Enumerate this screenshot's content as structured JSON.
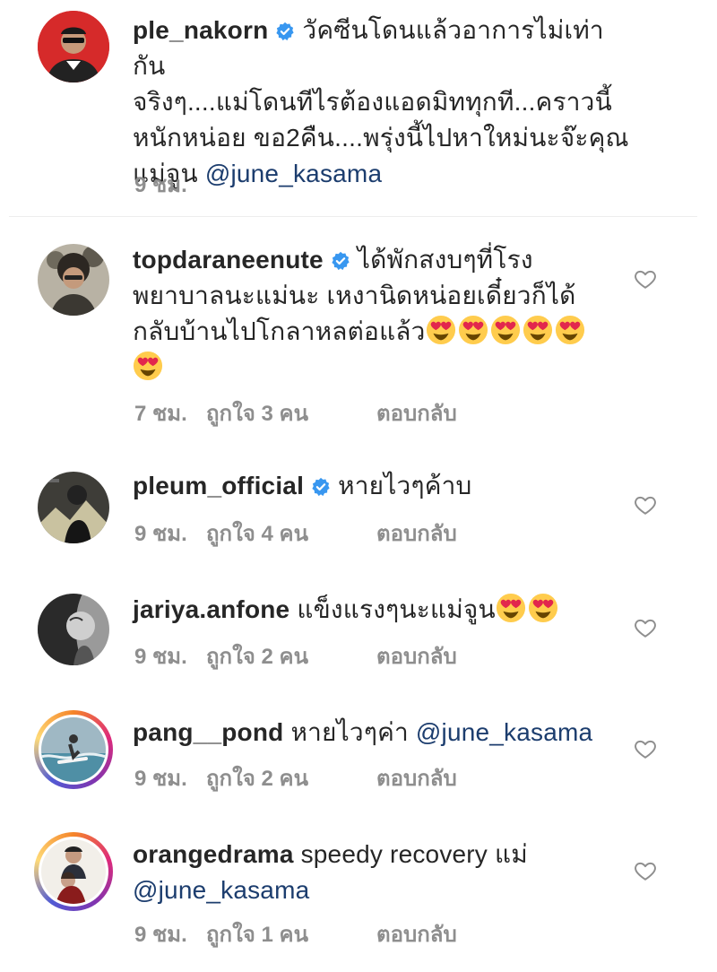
{
  "comments": [
    {
      "username": "ple_nakorn",
      "verified": true,
      "text": "วัคซีนโดนแล้วอาการไม่เท่ากันจริงๆ....แม่โดนทีไรต้องแอดมิททุกที...คราวนี้หนักหน่อย ขอ2คืน....พรุ่งนี้ไปหาใหม่นะจ๊ะคุณแม่จูน",
      "text_lines": [
        "วัคซีนโดนแล้วอาการไม่เท่ากัน",
        "จริงๆ....แม่โดนทีไรต้องแอดมิททุกที...คราวนี้",
        "หนักหน่อย ขอ2คืน....พรุ่งนี้ไปหาใหม่นะจ๊ะคุณ",
        "แม่จูน "
      ],
      "mention": "@june_kasama",
      "time": "9 ชม.",
      "likes": "",
      "reply": ""
    },
    {
      "username": "topdaraneenute",
      "verified": true,
      "text_lines": [
        "ได้พักสงบๆที่โรง",
        "พยาบาลนะแม่นะ เหงานิดหน่อยเดี๋ยวก็ได้",
        "กลับบ้านไปโกลาหลต่อแล้ว"
      ],
      "emoji_count": 6,
      "time": "7 ชม.",
      "likes": "ถูกใจ 3 คน",
      "reply": "ตอบกลับ"
    },
    {
      "username": "pleum_official",
      "verified": true,
      "text": "หายไวๆค้าบ",
      "time": "9 ชม.",
      "likes": "ถูกใจ 4 คน",
      "reply": "ตอบกลับ"
    },
    {
      "username": "jariya.anfone",
      "verified": false,
      "text": "แข็งแรงๆนะแม่จูน",
      "emoji_count": 2,
      "time": "9 ชม.",
      "likes": "ถูกใจ 2 คน",
      "reply": "ตอบกลับ"
    },
    {
      "username": "pang__pond",
      "verified": false,
      "text": "หายไวๆค่า ",
      "mention": "@june_kasama",
      "time": "9 ชม.",
      "likes": "ถูกใจ 2 คน",
      "reply": "ตอบกลับ"
    },
    {
      "username": "orangedrama",
      "verified": false,
      "text": "speedy recovery แม่",
      "mention": "@june_kasama",
      "time": "9 ชม.",
      "likes": "ถูกใจ 1 คน",
      "reply": "ตอบกลับ"
    }
  ],
  "icons": {
    "verified": "verified-badge-icon",
    "like": "heart-outline-icon",
    "emoji": "heart-eyes-emoji"
  },
  "colors": {
    "verified": "#3897f0",
    "mention": "#1c3d6e",
    "meta": "#8e8e8e"
  }
}
